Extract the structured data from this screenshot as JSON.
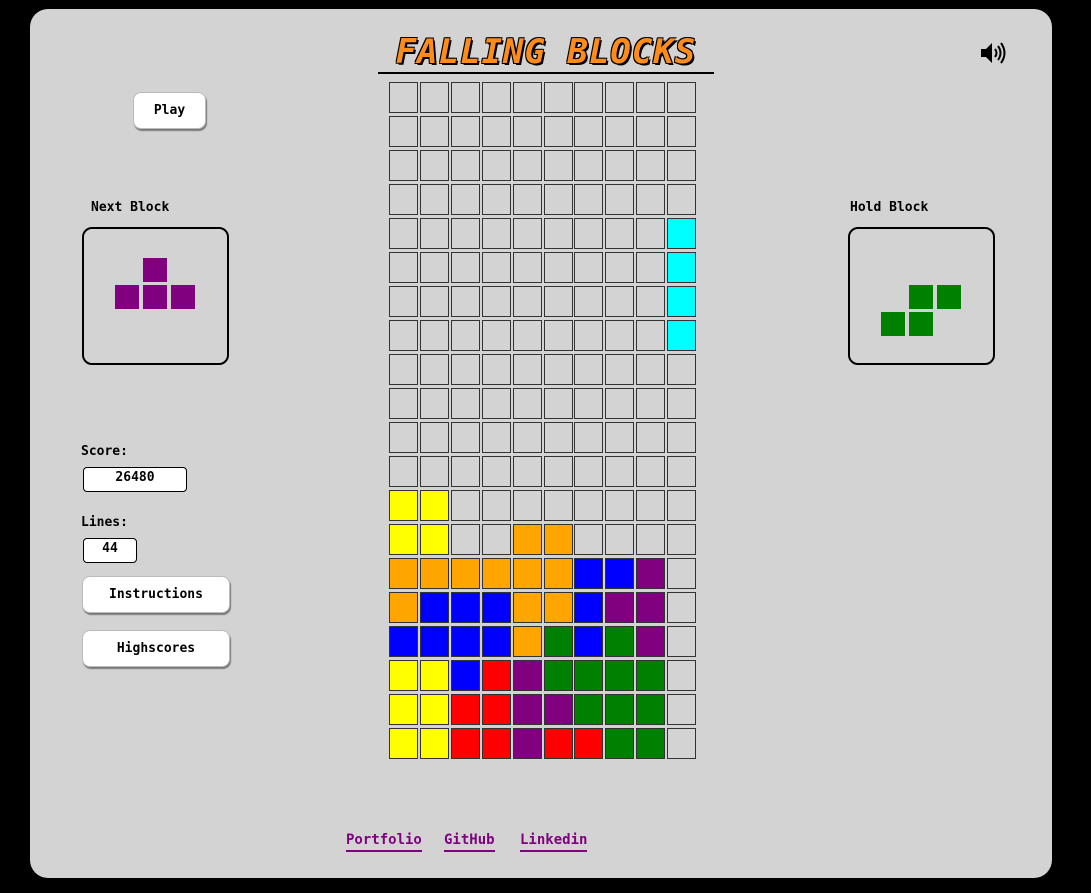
{
  "app": {
    "title": "FALLING BLOCKS"
  },
  "controls": {
    "play_label": "Play",
    "instructions_label": "Instructions",
    "highscores_label": "Highscores",
    "sound_icon": "speaker-volume-icon"
  },
  "next_block": {
    "label": "Next Block",
    "piece": "T",
    "color": "#800080",
    "cells": [
      [
        1,
        0
      ],
      [
        0,
        1
      ],
      [
        1,
        1
      ],
      [
        2,
        1
      ]
    ]
  },
  "hold_block": {
    "label": "Hold Block",
    "piece": "S",
    "color": "#008000",
    "cells": [
      [
        1,
        0
      ],
      [
        2,
        0
      ],
      [
        0,
        1
      ],
      [
        1,
        1
      ]
    ]
  },
  "stats": {
    "score_label": "Score:",
    "score_value": "26480",
    "lines_label": "Lines:",
    "lines_value": "44"
  },
  "colors": {
    "background": "#d3d3d3",
    "title": "#ff8c1a",
    "link": "#800080",
    "C": "#00ffff",
    "Y": "#ffff00",
    "O": "#ffa500",
    "B": "#0000ff",
    "P": "#800080",
    "G": "#008000",
    "R": "#ff0000"
  },
  "board": {
    "columns": 10,
    "rows": 20,
    "grid": [
      "..........",
      "..........",
      "..........",
      "..........",
      ".........C",
      ".........C",
      ".........C",
      ".........C",
      "..........",
      "..........",
      "..........",
      "..........",
      "YY........",
      "YY..OO....",
      "OOOOOOBBP.",
      "OBBBOOBPP.",
      "BBBBOGBGP.",
      "YYBRPGGGG.",
      "YYRRPPGGG.",
      "YYRRPRRGG."
    ]
  },
  "footer": {
    "links": [
      "Portfolio",
      "GitHub",
      "Linkedin"
    ]
  }
}
